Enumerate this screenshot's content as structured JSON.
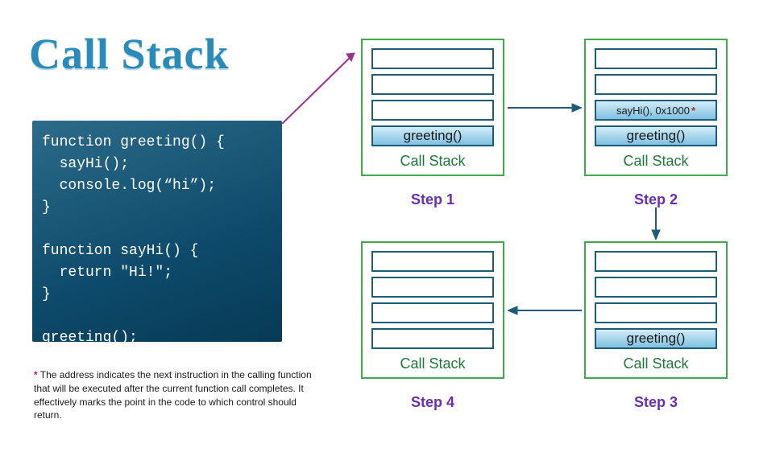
{
  "title": "Call Stack",
  "code": "function greeting() {\n  sayHi();\n  console.log(“hi”);\n}\n\nfunction sayHi() {\n  return \"Hi!\";\n}\n\ngreeting();",
  "footnote": {
    "marker": "*",
    "text": " The address indicates the next instruction in the calling function that will be executed after the current function call completes. It effectively marks the point in the code to which control should return."
  },
  "stacks": {
    "step1": {
      "label": "Step 1",
      "cs_label": "Call Stack",
      "slots": [
        "",
        "",
        "",
        "greeting()"
      ]
    },
    "step2": {
      "label": "Step 2",
      "cs_label": "Call Stack",
      "slots": [
        "",
        "",
        "sayHi(), 0x1000",
        "greeting()"
      ],
      "slot2_has_star": true
    },
    "step3": {
      "label": "Step 3",
      "cs_label": "Call Stack",
      "slots": [
        "",
        "",
        "",
        "greeting()"
      ]
    },
    "step4": {
      "label": "Step 4",
      "cs_label": "Call Stack",
      "slots": [
        "",
        "",
        "",
        ""
      ]
    }
  }
}
